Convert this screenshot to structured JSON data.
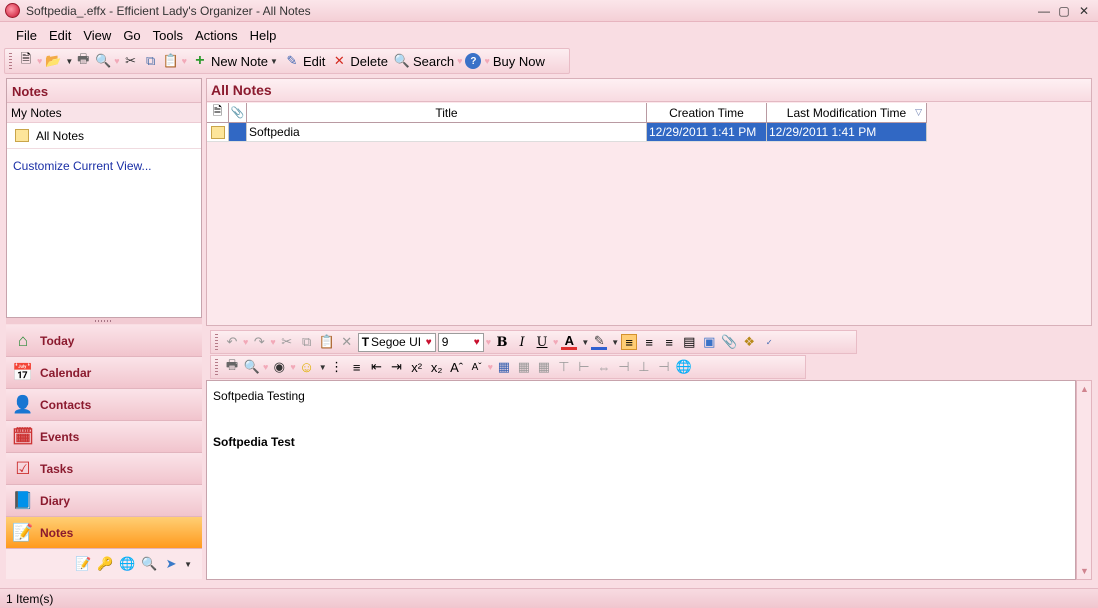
{
  "window": {
    "title": "Softpedia_.effx - Efficient Lady's Organizer - All Notes"
  },
  "menu": [
    "File",
    "Edit",
    "View",
    "Go",
    "Tools",
    "Actions",
    "Help"
  ],
  "toolbar": {
    "new_note": "New Note",
    "edit": "Edit",
    "delete": "Delete",
    "search": "Search",
    "buy_now": "Buy Now"
  },
  "left_pane": {
    "header": "Notes",
    "group": "My Notes",
    "folder": "All Notes",
    "customize": "Customize Current View..."
  },
  "nav": [
    {
      "label": "Today",
      "icon": "home-icon"
    },
    {
      "label": "Calendar",
      "icon": "calendar-icon"
    },
    {
      "label": "Contacts",
      "icon": "contacts-icon"
    },
    {
      "label": "Events",
      "icon": "events-icon"
    },
    {
      "label": "Tasks",
      "icon": "tasks-icon"
    },
    {
      "label": "Diary",
      "icon": "diary-icon"
    },
    {
      "label": "Notes",
      "icon": "notes-icon",
      "active": true
    }
  ],
  "notes_list": {
    "header": "All Notes",
    "columns": {
      "title": "Title",
      "created": "Creation Time",
      "modified": "Last Modification Time"
    },
    "rows": [
      {
        "title": "Softpedia",
        "created": "12/29/2011 1:41 PM",
        "modified": "12/29/2011 1:41 PM"
      }
    ]
  },
  "editor_toolbar": {
    "font": "Segoe UI",
    "size": "9"
  },
  "editor": {
    "line1": "Softpedia Testing",
    "line2": "Softpedia Test"
  },
  "status": {
    "items": "1 Item(s)"
  },
  "colors": {
    "accent": "#8b1a2e",
    "selection": "#3168c4",
    "background": "#f9dde3"
  }
}
